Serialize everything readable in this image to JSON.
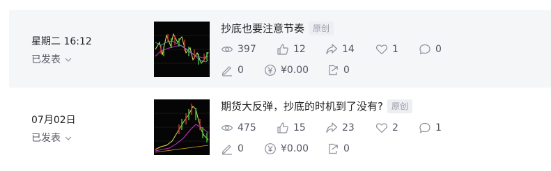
{
  "articles": [
    {
      "date": "星期二 16:12",
      "status": "已发表",
      "title": "抄底也要注意节奏",
      "tag": "原创",
      "views": "397",
      "likes": "12",
      "shares": "14",
      "favorites": "1",
      "comments": "0",
      "edits": "0",
      "income": "¥0.00",
      "exports": "0"
    },
    {
      "date": "07月02日",
      "status": "已发表",
      "title": "期货大反弹，抄底的时机到了没有?",
      "tag": "原创",
      "views": "475",
      "likes": "15",
      "shares": "23",
      "favorites": "2",
      "comments": "1",
      "edits": "0",
      "income": "¥0.00",
      "exports": "0"
    }
  ],
  "colors": {
    "row_highlight": "#f5f6f7",
    "text_primary": "#222226",
    "text_secondary": "#555666",
    "icon": "#8a8f99",
    "tag_bg": "#eeeff2"
  }
}
